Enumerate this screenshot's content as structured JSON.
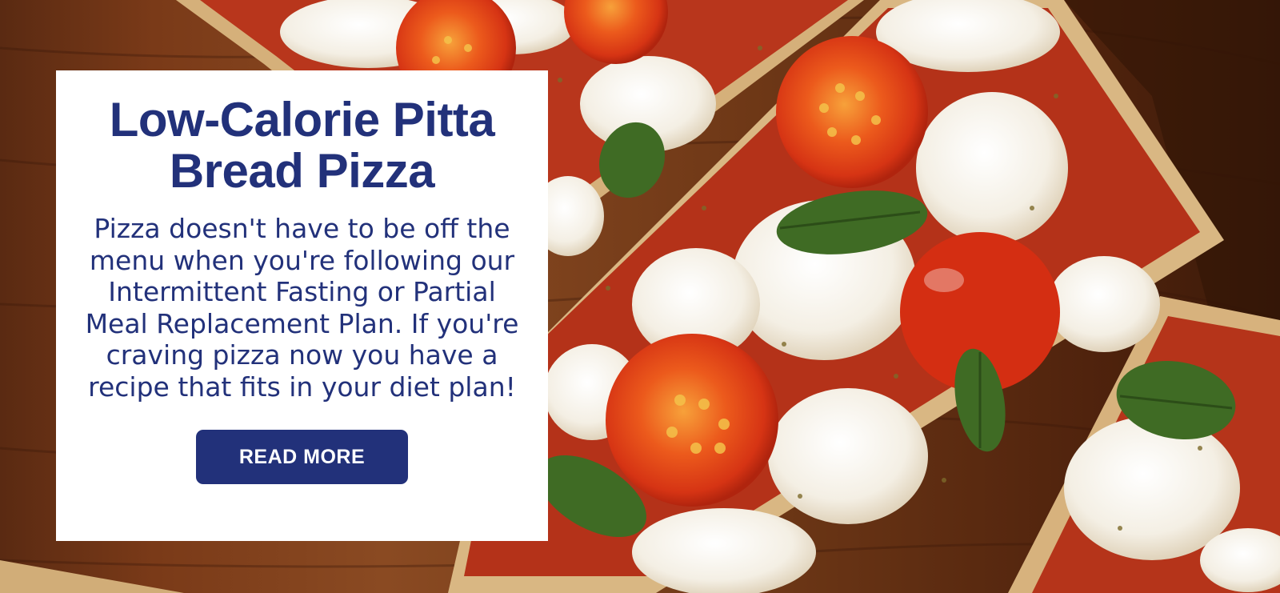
{
  "hero": {
    "image_icon": "pizza-photo",
    "title": "Low-Calorie Pitta Bread Pizza",
    "description": "Pizza doesn't have to be off the menu when you're following our Intermittent Fasting or Partial Meal Replacement Plan. If you're craving pizza now you have a recipe that fits in your diet plan!",
    "cta_label": "READ MORE"
  },
  "colors": {
    "brand_navy": "#22317a",
    "card_background": "#ffffff",
    "button_text": "#ffffff"
  }
}
